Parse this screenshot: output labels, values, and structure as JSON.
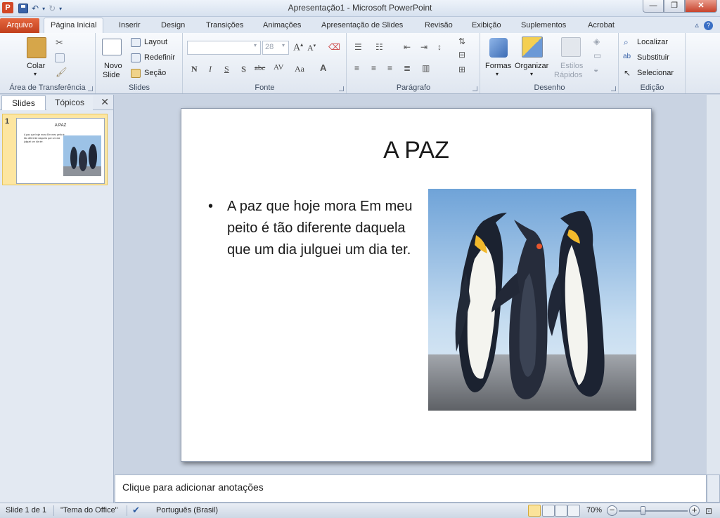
{
  "window": {
    "title": "Apresentação1  -  Microsoft PowerPoint"
  },
  "qat": {
    "app_icon": "P"
  },
  "tabs": {
    "file": "Arquivo",
    "items": [
      "Página Inicial",
      "Inserir",
      "Design",
      "Transições",
      "Animações",
      "Apresentação de Slides",
      "Revisão",
      "Exibição",
      "Suplementos",
      "Acrobat"
    ],
    "active_index": 0
  },
  "ribbon": {
    "clipboard": {
      "label": "Área de Transferência",
      "paste": "Colar"
    },
    "slides": {
      "label": "Slides",
      "new_slide_1": "Novo",
      "new_slide_2": "Slide",
      "layout": "Layout",
      "reset": "Redefinir",
      "section": "Seção"
    },
    "font": {
      "label": "Fonte",
      "family": "",
      "size": "28",
      "bold": "N",
      "italic": "I",
      "underline": "S",
      "shadow": "S",
      "strike": "abc",
      "spacing": "AV",
      "case": "Aa"
    },
    "paragraph": {
      "label": "Parágrafo"
    },
    "drawing": {
      "label": "Desenho",
      "shapes": "Formas",
      "arrange": "Organizar",
      "styles_1": "Estilos",
      "styles_2": "Rápidos"
    },
    "editing": {
      "label": "Edição",
      "find": "Localizar",
      "replace": "Substituir",
      "select": "Selecionar"
    }
  },
  "leftpanel": {
    "tab_slides": "Slides",
    "tab_outline": "Tópicos",
    "thumb_number": "1"
  },
  "slide": {
    "title": "A PAZ",
    "bullet": "A paz que hoje mora Em meu peito é tão diferente daquela que um dia julguei um dia ter."
  },
  "notes": {
    "placeholder": "Clique para adicionar anotações"
  },
  "status": {
    "slide_info": "Slide 1 de 1",
    "theme": "\"Tema do Office\"",
    "language": "Português (Brasil)",
    "zoom": "70%"
  },
  "colors": {
    "accent_file_tab": "#d24726",
    "ribbon_bg": "#dfe6f0",
    "workspace_bg": "#c9d3e2",
    "thumb_selected": "#fde6a1"
  }
}
